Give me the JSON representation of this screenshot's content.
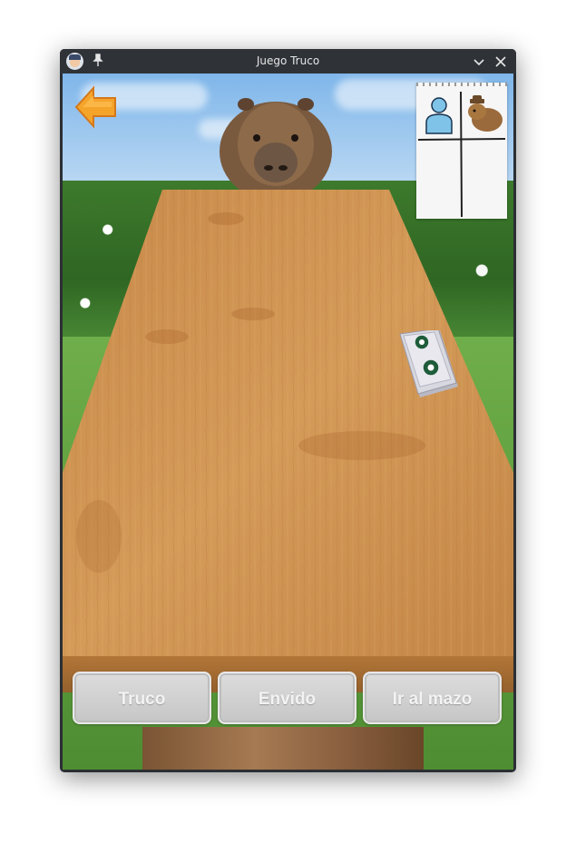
{
  "window": {
    "title": "Juego Truco",
    "controls": {
      "minimize_icon": "chevron-down-icon",
      "close_icon": "close-icon"
    }
  },
  "game": {
    "back_icon": "back-arrow-icon",
    "scoreboard": {
      "columns": [
        {
          "icon": "player-icon"
        },
        {
          "icon": "capybara-icon"
        }
      ]
    },
    "deck_icon": "card-deck-icon",
    "actions": [
      {
        "label": "Truco"
      },
      {
        "label": "Envido"
      },
      {
        "label": "Ir al mazo"
      }
    ]
  },
  "colors": {
    "titlebar": "#2f3338",
    "button_face": "#d2d2d2",
    "button_text": "#f3f3f3",
    "back_arrow": "#f5a42a",
    "player_icon": "#7fc4e8"
  }
}
